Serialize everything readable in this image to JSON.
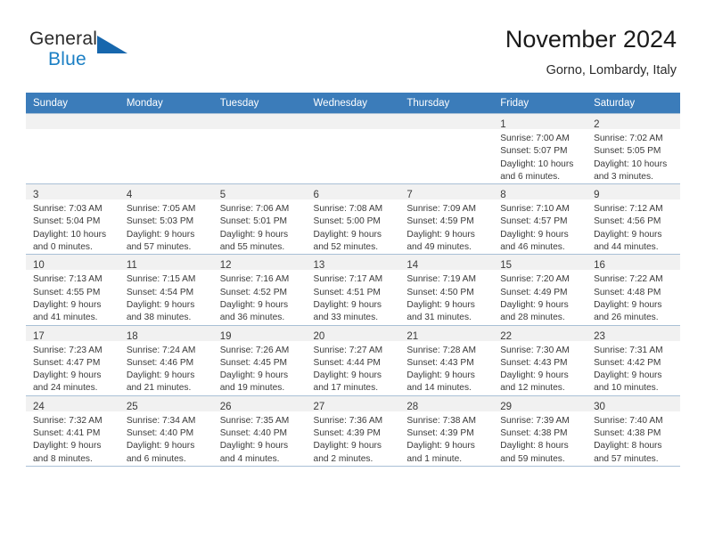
{
  "brand": {
    "name_top": "General",
    "name_bottom": "Blue",
    "triangle_color": "#1767ad",
    "blue_color": "#1b7fc4"
  },
  "header": {
    "title": "November 2024",
    "subtitle": "Gorno, Lombardy, Italy"
  },
  "theme": {
    "header_row_bg": "#3b7cba",
    "daynum_band_bg": "#f1f1f1",
    "grid_line": "#a9c0d6"
  },
  "weekdays": [
    "Sunday",
    "Monday",
    "Tuesday",
    "Wednesday",
    "Thursday",
    "Friday",
    "Saturday"
  ],
  "weeks": [
    [
      {
        "day": "",
        "lines": []
      },
      {
        "day": "",
        "lines": []
      },
      {
        "day": "",
        "lines": []
      },
      {
        "day": "",
        "lines": []
      },
      {
        "day": "",
        "lines": []
      },
      {
        "day": "1",
        "lines": [
          "Sunrise: 7:00 AM",
          "Sunset: 5:07 PM",
          "Daylight: 10 hours",
          "and 6 minutes."
        ]
      },
      {
        "day": "2",
        "lines": [
          "Sunrise: 7:02 AM",
          "Sunset: 5:05 PM",
          "Daylight: 10 hours",
          "and 3 minutes."
        ]
      }
    ],
    [
      {
        "day": "3",
        "lines": [
          "Sunrise: 7:03 AM",
          "Sunset: 5:04 PM",
          "Daylight: 10 hours",
          "and 0 minutes."
        ]
      },
      {
        "day": "4",
        "lines": [
          "Sunrise: 7:05 AM",
          "Sunset: 5:03 PM",
          "Daylight: 9 hours",
          "and 57 minutes."
        ]
      },
      {
        "day": "5",
        "lines": [
          "Sunrise: 7:06 AM",
          "Sunset: 5:01 PM",
          "Daylight: 9 hours",
          "and 55 minutes."
        ]
      },
      {
        "day": "6",
        "lines": [
          "Sunrise: 7:08 AM",
          "Sunset: 5:00 PM",
          "Daylight: 9 hours",
          "and 52 minutes."
        ]
      },
      {
        "day": "7",
        "lines": [
          "Sunrise: 7:09 AM",
          "Sunset: 4:59 PM",
          "Daylight: 9 hours",
          "and 49 minutes."
        ]
      },
      {
        "day": "8",
        "lines": [
          "Sunrise: 7:10 AM",
          "Sunset: 4:57 PM",
          "Daylight: 9 hours",
          "and 46 minutes."
        ]
      },
      {
        "day": "9",
        "lines": [
          "Sunrise: 7:12 AM",
          "Sunset: 4:56 PM",
          "Daylight: 9 hours",
          "and 44 minutes."
        ]
      }
    ],
    [
      {
        "day": "10",
        "lines": [
          "Sunrise: 7:13 AM",
          "Sunset: 4:55 PM",
          "Daylight: 9 hours",
          "and 41 minutes."
        ]
      },
      {
        "day": "11",
        "lines": [
          "Sunrise: 7:15 AM",
          "Sunset: 4:54 PM",
          "Daylight: 9 hours",
          "and 38 minutes."
        ]
      },
      {
        "day": "12",
        "lines": [
          "Sunrise: 7:16 AM",
          "Sunset: 4:52 PM",
          "Daylight: 9 hours",
          "and 36 minutes."
        ]
      },
      {
        "day": "13",
        "lines": [
          "Sunrise: 7:17 AM",
          "Sunset: 4:51 PM",
          "Daylight: 9 hours",
          "and 33 minutes."
        ]
      },
      {
        "day": "14",
        "lines": [
          "Sunrise: 7:19 AM",
          "Sunset: 4:50 PM",
          "Daylight: 9 hours",
          "and 31 minutes."
        ]
      },
      {
        "day": "15",
        "lines": [
          "Sunrise: 7:20 AM",
          "Sunset: 4:49 PM",
          "Daylight: 9 hours",
          "and 28 minutes."
        ]
      },
      {
        "day": "16",
        "lines": [
          "Sunrise: 7:22 AM",
          "Sunset: 4:48 PM",
          "Daylight: 9 hours",
          "and 26 minutes."
        ]
      }
    ],
    [
      {
        "day": "17",
        "lines": [
          "Sunrise: 7:23 AM",
          "Sunset: 4:47 PM",
          "Daylight: 9 hours",
          "and 24 minutes."
        ]
      },
      {
        "day": "18",
        "lines": [
          "Sunrise: 7:24 AM",
          "Sunset: 4:46 PM",
          "Daylight: 9 hours",
          "and 21 minutes."
        ]
      },
      {
        "day": "19",
        "lines": [
          "Sunrise: 7:26 AM",
          "Sunset: 4:45 PM",
          "Daylight: 9 hours",
          "and 19 minutes."
        ]
      },
      {
        "day": "20",
        "lines": [
          "Sunrise: 7:27 AM",
          "Sunset: 4:44 PM",
          "Daylight: 9 hours",
          "and 17 minutes."
        ]
      },
      {
        "day": "21",
        "lines": [
          "Sunrise: 7:28 AM",
          "Sunset: 4:43 PM",
          "Daylight: 9 hours",
          "and 14 minutes."
        ]
      },
      {
        "day": "22",
        "lines": [
          "Sunrise: 7:30 AM",
          "Sunset: 4:43 PM",
          "Daylight: 9 hours",
          "and 12 minutes."
        ]
      },
      {
        "day": "23",
        "lines": [
          "Sunrise: 7:31 AM",
          "Sunset: 4:42 PM",
          "Daylight: 9 hours",
          "and 10 minutes."
        ]
      }
    ],
    [
      {
        "day": "24",
        "lines": [
          "Sunrise: 7:32 AM",
          "Sunset: 4:41 PM",
          "Daylight: 9 hours",
          "and 8 minutes."
        ]
      },
      {
        "day": "25",
        "lines": [
          "Sunrise: 7:34 AM",
          "Sunset: 4:40 PM",
          "Daylight: 9 hours",
          "and 6 minutes."
        ]
      },
      {
        "day": "26",
        "lines": [
          "Sunrise: 7:35 AM",
          "Sunset: 4:40 PM",
          "Daylight: 9 hours",
          "and 4 minutes."
        ]
      },
      {
        "day": "27",
        "lines": [
          "Sunrise: 7:36 AM",
          "Sunset: 4:39 PM",
          "Daylight: 9 hours",
          "and 2 minutes."
        ]
      },
      {
        "day": "28",
        "lines": [
          "Sunrise: 7:38 AM",
          "Sunset: 4:39 PM",
          "Daylight: 9 hours",
          "and 1 minute."
        ]
      },
      {
        "day": "29",
        "lines": [
          "Sunrise: 7:39 AM",
          "Sunset: 4:38 PM",
          "Daylight: 8 hours",
          "and 59 minutes."
        ]
      },
      {
        "day": "30",
        "lines": [
          "Sunrise: 7:40 AM",
          "Sunset: 4:38 PM",
          "Daylight: 8 hours",
          "and 57 minutes."
        ]
      }
    ]
  ]
}
